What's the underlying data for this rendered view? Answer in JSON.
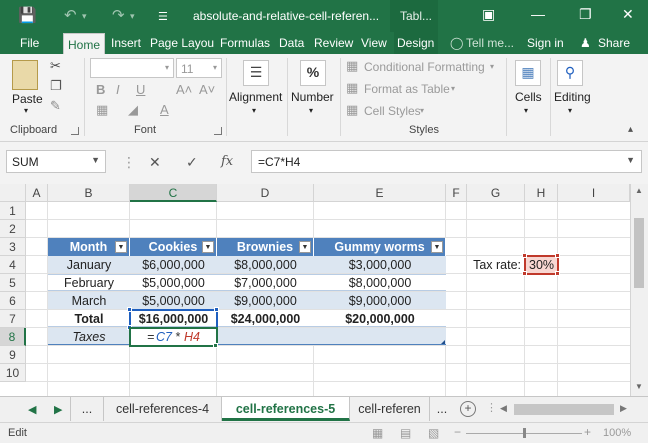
{
  "window": {
    "title": "absolute-and-relative-cell-referen...",
    "context_tab": "Tabl..."
  },
  "tabs": [
    {
      "label": "File"
    },
    {
      "label": "Home"
    },
    {
      "label": "Insert"
    },
    {
      "label": "Page Layou"
    },
    {
      "label": "Formulas"
    },
    {
      "label": "Data"
    },
    {
      "label": "Review"
    },
    {
      "label": "View"
    },
    {
      "label": "Design"
    }
  ],
  "tell_me": "Tell me...",
  "sign_in": "Sign in",
  "share": "Share",
  "ribbon": {
    "clipboard": {
      "paste": "Paste",
      "label": "Clipboard"
    },
    "font": {
      "name": "",
      "size": "11",
      "label": "Font"
    },
    "alignment": {
      "label": "Alignment"
    },
    "number": {
      "label": "Number"
    },
    "styles": {
      "conditional": "Conditional Formatting",
      "format_table": "Format as Table",
      "cell_styles": "Cell Styles",
      "label": "Styles"
    },
    "cells": {
      "label": "Cells"
    },
    "editing": {
      "label": "Editing"
    }
  },
  "formula_bar": {
    "name_box": "SUM",
    "formula": "=C7*H4",
    "fx": "fx"
  },
  "columns": [
    "A",
    "B",
    "C",
    "D",
    "E",
    "F",
    "G",
    "H",
    "I"
  ],
  "rows": [
    "1",
    "2",
    "3",
    "4",
    "5",
    "6",
    "7",
    "8",
    "9",
    "10"
  ],
  "table": {
    "headers": [
      "Month",
      "Cookies",
      "Brownies",
      "Gummy worms"
    ],
    "rows": [
      [
        "January",
        "$6,000,000",
        "$8,000,000",
        "$3,000,000"
      ],
      [
        "February",
        "$5,000,000",
        "$7,000,000",
        "$8,000,000"
      ],
      [
        "March",
        "$5,000,000",
        "$9,000,000",
        "$9,000,000"
      ]
    ],
    "total": [
      "Total",
      "$16,000,000",
      "$24,000,000",
      "$20,000,000"
    ],
    "taxes_label": "Taxes",
    "taxes_formula": {
      "eq": "=",
      "ref1": "C7",
      "op": "*",
      "ref2": "H4"
    }
  },
  "tax": {
    "label": "Tax rate:",
    "value": "30%"
  },
  "sheets": {
    "more": "...",
    "tabs": [
      "cell-references-4",
      "cell-references-5",
      "cell-referen"
    ],
    "active_index": 1
  },
  "status": {
    "mode": "Edit",
    "zoom": "100%"
  },
  "colors": {
    "excel_green": "#217346",
    "table_header": "#4f81bd",
    "band": "#dce6f1"
  }
}
